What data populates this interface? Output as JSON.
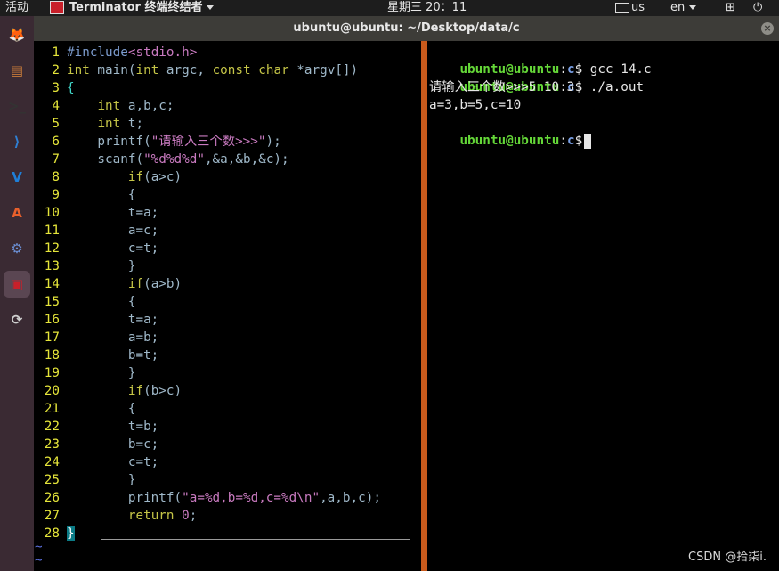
{
  "topbar": {
    "activities": "活动",
    "app_name": "Terminator 终端终结者",
    "clock": "星期三 20：11",
    "keyboard": "us",
    "lang": "en"
  },
  "window": {
    "title": "ubuntu@ubuntu: ~/Desktop/data/c",
    "close": "×"
  },
  "dock": {
    "items": [
      {
        "name": "firefox-icon",
        "glyph": "🦊",
        "color": "#e66000"
      },
      {
        "name": "files-icon",
        "glyph": "▤",
        "color": "#c97b3a"
      },
      {
        "name": "terminal-icon",
        "glyph": ">_",
        "color": "#333333"
      },
      {
        "name": "vscode-icon",
        "glyph": "⟩",
        "color": "#2f7fd3"
      },
      {
        "name": "vscode-alt-icon",
        "glyph": "V",
        "color": "#1f7fd8"
      },
      {
        "name": "software-center-icon",
        "glyph": "A",
        "color": "#e8602c"
      },
      {
        "name": "settings-icon",
        "glyph": "⚙",
        "color": "#6b8fd4"
      },
      {
        "name": "terminator-icon",
        "glyph": "▣",
        "color": "#c8202a"
      },
      {
        "name": "update-icon",
        "glyph": "⟳",
        "color": "#d0d0d0"
      }
    ]
  },
  "editor": {
    "lines": [
      {
        "n": "1",
        "text": "#include<stdio.h>"
      },
      {
        "n": "2",
        "text": "int main(int argc, const char *argv[])"
      },
      {
        "n": "3",
        "text": "{"
      },
      {
        "n": "4",
        "text": "    int a,b,c;"
      },
      {
        "n": "5",
        "text": "    int t;"
      },
      {
        "n": "6",
        "text": "    printf(\"请输入三个数>>>\");"
      },
      {
        "n": "7",
        "text": "    scanf(\"%d%d%d\",&a,&b,&c);"
      },
      {
        "n": "8",
        "text": "        if(a>c)"
      },
      {
        "n": "9",
        "text": "        {"
      },
      {
        "n": "10",
        "text": "        t=a;"
      },
      {
        "n": "11",
        "text": "        a=c;"
      },
      {
        "n": "12",
        "text": "        c=t;"
      },
      {
        "n": "13",
        "text": "        }"
      },
      {
        "n": "14",
        "text": "        if(a>b)"
      },
      {
        "n": "15",
        "text": "        {"
      },
      {
        "n": "16",
        "text": "        t=a;"
      },
      {
        "n": "17",
        "text": "        a=b;"
      },
      {
        "n": "18",
        "text": "        b=t;"
      },
      {
        "n": "19",
        "text": "        }"
      },
      {
        "n": "20",
        "text": "        if(b>c)"
      },
      {
        "n": "21",
        "text": "        {"
      },
      {
        "n": "22",
        "text": "        t=b;"
      },
      {
        "n": "23",
        "text": "        b=c;"
      },
      {
        "n": "24",
        "text": "        c=t;"
      },
      {
        "n": "25",
        "text": "        }"
      },
      {
        "n": "26",
        "text": "        printf(\"a=%d,b=%d,c=%d\\n\",a,b,c);"
      },
      {
        "n": "27",
        "text": "        return 0;"
      },
      {
        "n": "28",
        "text": "}"
      }
    ],
    "tilde": "~"
  },
  "terminal": {
    "user": "ubuntu@ubuntu",
    "sep": ":",
    "path": "c",
    "dollar": "$",
    "cmd1": " gcc 14.c",
    "cmd2": " ./a.out",
    "out1": "请输入三个数>>>5 10 3",
    "out2": "a=3,b=5,c=10"
  },
  "watermark": "CSDN @拾柒i."
}
